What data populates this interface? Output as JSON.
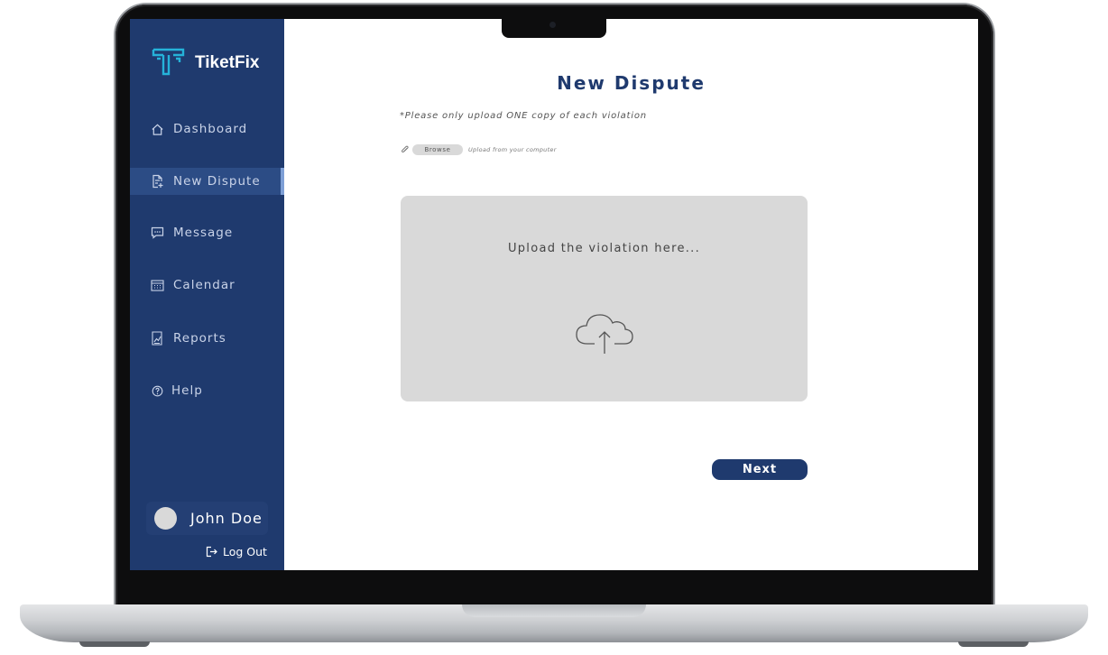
{
  "app": {
    "name": "TiketFix"
  },
  "sidebar": {
    "items": [
      {
        "label": "Dashboard",
        "icon": "home-icon"
      },
      {
        "label": "New Dispute",
        "icon": "file-add-icon",
        "active": true
      },
      {
        "label": "Message",
        "icon": "chat-icon"
      },
      {
        "label": "Calendar",
        "icon": "calendar-icon"
      },
      {
        "label": "Reports",
        "icon": "report-icon"
      },
      {
        "label": "Help",
        "icon": "help-icon"
      }
    ],
    "user": {
      "name": "John Doe"
    },
    "logout_label": "Log Out"
  },
  "main": {
    "title": "New Dispute",
    "note": "*Please only upload ONE copy of each violation",
    "browse": {
      "label": "Browse",
      "hint": "Upload from your computer"
    },
    "dropzone": {
      "text": "Upload the violation here..."
    },
    "next_label": "Next"
  },
  "colors": {
    "sidebar_bg": "#1f3a6e",
    "accent": "#1f3a6e",
    "dropzone_bg": "#d9d9d9"
  }
}
